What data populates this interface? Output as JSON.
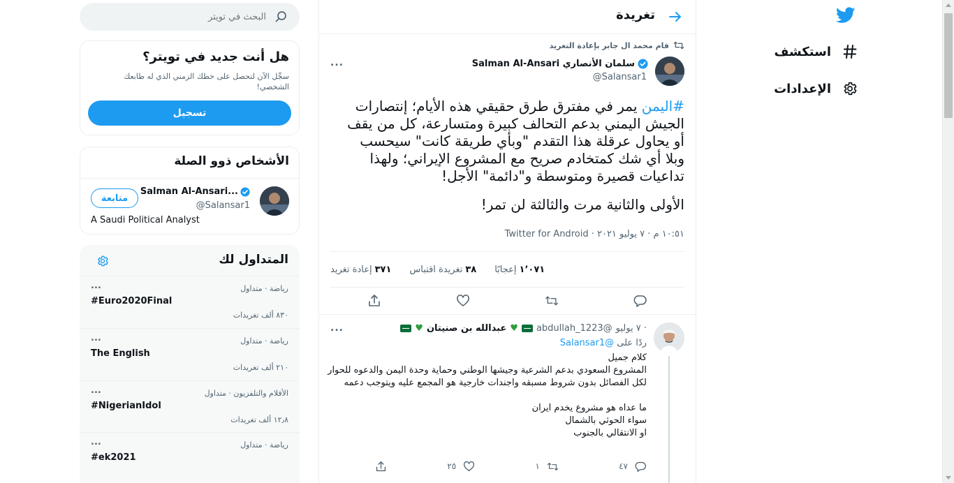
{
  "nav": {
    "logo_icon": "twitter-bird-icon",
    "items": [
      {
        "label": "استكشف",
        "icon": "hashtag-icon"
      },
      {
        "label": "الإعدادات",
        "icon": "gear-icon"
      }
    ]
  },
  "header": {
    "title": "تغريدة",
    "back_icon": "arrow-right-icon"
  },
  "tweet": {
    "retweeted_by": "قام محمد ال جابر بإعادة التغريد",
    "author_name": "سلمان الأنصاري Salman Al-Ansari",
    "handle": "@Salansar1",
    "hashtag": "#اليمن",
    "text_1": " يمر في مفترق طرق حقيقي هذه الأيام؛ إنتصارات الجيش اليمني بدعم التحالف كبيرة ومتسارعة، كل من يقف أو يحاول عرقلة هذا التقدم \"وبأي طريقة كانت\" سيحسب وبلا أي شك كمتخادم صريح مع المشروع الإيراني؛ ولهذا تداعيات قصيرة ومتوسطة و\"دائمة\" الأجل!",
    "text_2": "الأولى والثانية مرت والثالثة لن تمر!",
    "meta": "١٠:٥١ م · ٧ يوليو ٢٠٢١ · Twitter for Android",
    "stats": {
      "retweets_num": "٣٧١",
      "retweets_label": "إعادة تغريد",
      "quotes_num": "٣٨",
      "quotes_label": "تغريدة اقتباس",
      "likes_num": "١٬٠٧١",
      "likes_label": "إعجابًا"
    },
    "more": "..."
  },
  "reply": {
    "name": "عبدالله بن صنيتان",
    "handle": "@1223_abdullah",
    "date": "· ٧ يوليو",
    "replying_prefix": "ردًا على",
    "replying_mention": "@Salansar1",
    "body": "كلام جميل\nالمشروع السعودي بدعم الشرعية وجيشها الوطني وحماية وحدة اليمن والدعوه للحوار لكل الفصائل بدون شروط مسبقه واجندات خارجية هو المجمع عليه ويتوجب دعمه\n\nما عداه هو مشروع يخدم ايران\nسواء الحوثي بالشمال\nاو الانتقالي بالجنوب",
    "replies": "٤٧",
    "retweets": "١",
    "likes": "٢٥",
    "more": "..."
  },
  "search": {
    "placeholder": "البحث في تويتر"
  },
  "new_to_twitter": {
    "title": "هل أنت جديد في تويتر؟",
    "subtitle": "سجِّل الآن لتحصل على خطك الزمني الذي له طابعك الشخصي!",
    "button": "تسجيل"
  },
  "relevant": {
    "title": "الأشخاص ذوو الصلة",
    "name": "Salman Al-Ansari...",
    "handle": "@Salansar1",
    "bio": "A Saudi Political Analyst",
    "follow": "متابعة"
  },
  "trends": {
    "title": "المتداول لك",
    "items": [
      {
        "category": "رياضة · متداول",
        "name": "#Euro2020Final",
        "count": "٨٣٠ ألف تغريدات"
      },
      {
        "category": "رياضة · متداول",
        "name": "The English",
        "count": "٢١٠ ألف تغريدات"
      },
      {
        "category": "الأفلام والتلفزيون · متداول",
        "name": "#NigerianIdol",
        "count": "١٢٫٨ ألف تغريدات"
      },
      {
        "category": "رياضة · متداول",
        "name": "#ek2021",
        "count": ""
      }
    ],
    "more": "..."
  },
  "colors": {
    "accent": "#1d9bf0",
    "text": "#0f1419",
    "secondary": "#536471"
  }
}
